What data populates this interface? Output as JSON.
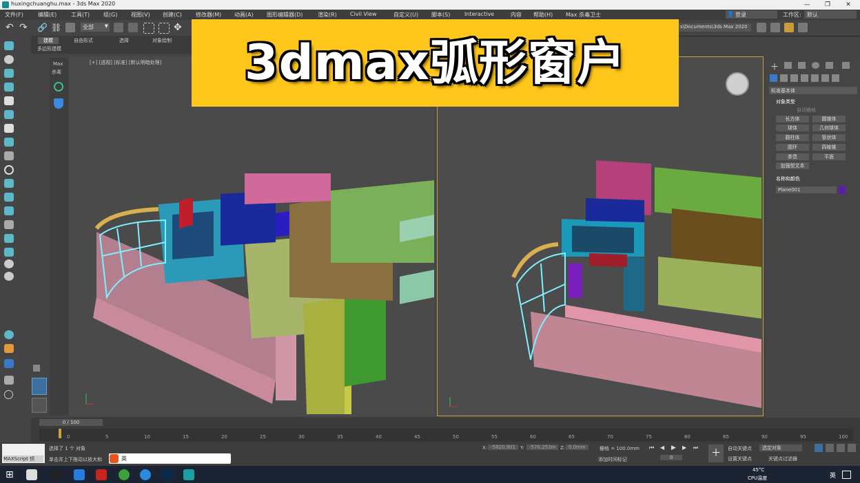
{
  "window": {
    "title": "huxingchuanghu.max - 3ds Max 2020",
    "search_label": "登录",
    "workspace_label": "工作区:",
    "workspace_value": "默认"
  },
  "menu": [
    "文件(F)",
    "编辑(E)",
    "工具(T)",
    "组(G)",
    "视图(V)",
    "创建(C)",
    "修改器(M)",
    "动画(A)",
    "图形编辑器(D)",
    "渲染(R)",
    "Civil View",
    "自定义(U)",
    "脚本(S)",
    "Interactive",
    "内容",
    "帮助(H)",
    "Max 杀毒卫士"
  ],
  "toolbar": {
    "selection_filter": "全部",
    "project_path": "s\\Documents\\3ds Max 2020"
  },
  "ribbon": {
    "tabs": [
      "建模",
      "自由形式",
      "选择",
      "对象绘制"
    ],
    "sub": "多边形建模"
  },
  "viewport_side": {
    "label1": "Max",
    "label2": "杀毒"
  },
  "viewport1": {
    "label": "[+] [透视] [标准] [默认明暗处理]"
  },
  "banner": {
    "title": "3dmax弧形窗户"
  },
  "command_panel": {
    "dropdown": "标准基本体",
    "object_type_header": "对象类型",
    "autogrid": "自动栅格",
    "buttons": [
      "长方体",
      "圆锥体",
      "球体",
      "几何球体",
      "圆柱体",
      "管状体",
      "圆环",
      "四棱锥",
      "茶壶",
      "平面",
      "加强型文本"
    ],
    "name_color_header": "名称和颜色",
    "object_name": "Plane001",
    "object_color": "#5a1ea8"
  },
  "timeline": {
    "frame": "0 / 100",
    "ticks": [
      "0",
      "5",
      "10",
      "15",
      "20",
      "25",
      "30",
      "35",
      "40",
      "45",
      "50",
      "55",
      "60",
      "65",
      "70",
      "75",
      "80",
      "85",
      "90",
      "95",
      "100"
    ]
  },
  "status": {
    "maxscript": "MAXScript 侦",
    "selected": "选择了 1 个 对象",
    "hint": "单击并上下拖动以放大和",
    "x_label": "X:",
    "x_value": "-5820.901",
    "y_label": "Y:",
    "y_value": "-570.253m",
    "z_label": "Z:",
    "z_value": "0.0mm",
    "grid": "栅格 = 100.0mm",
    "add_time_tag": "添加时间标记",
    "auto_key": "自动关键点",
    "set_key": "设置关键点",
    "selected_obj": "选定对象",
    "key_filter": "关键点过滤器",
    "frame_field": "0"
  },
  "taskbar": {
    "temp": "45°C",
    "cpu": "CPU温度",
    "lang": "英"
  },
  "colors": {
    "banner": "#ffc61b",
    "viewport_border": "#c9a33a"
  }
}
